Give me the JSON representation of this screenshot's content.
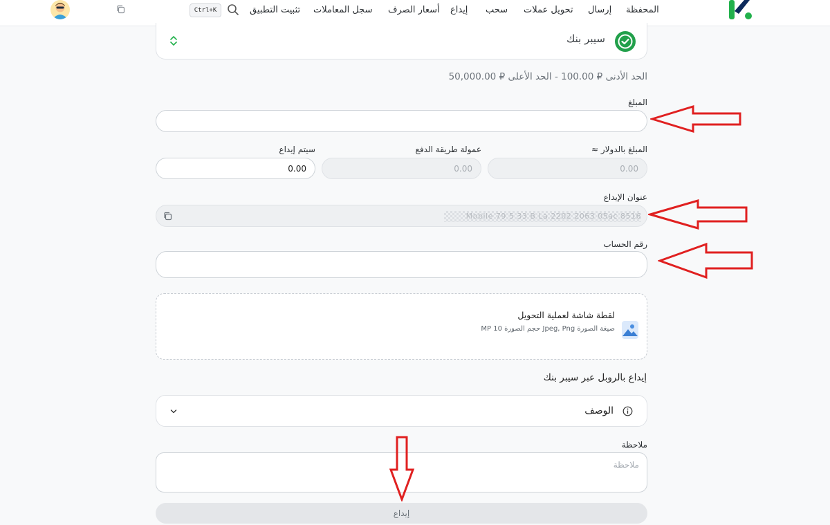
{
  "nav": {
    "items": [
      "المحفظة",
      "إرسال",
      "تحويل عملات",
      "سحب",
      "إيداع",
      "أسعار الصرف",
      "سجل المعاملات",
      "تثبيت التطبيق"
    ],
    "shortcut": "Ctrl+K"
  },
  "bank": {
    "name": "سيبر بنك"
  },
  "limits": {
    "min_label": "الحد الأدنى",
    "min_value": "₽ 100.00",
    "separator": "-",
    "max_label": "الحد الأعلى",
    "max_value": "₽ 50,000.00"
  },
  "form": {
    "amount_label": "المبلغ",
    "amount_value": "",
    "usd_label": "المبلغ بالدولار ≈",
    "usd_value": "0.00",
    "fee_label": "عمولة طريقة الدفع",
    "fee_value": "0.00",
    "deposit_label": "سيتم إيداع",
    "deposit_value": "0.00",
    "address_label": "عنوان الإيداع",
    "address_value": "Mobile 79 5 33 B La 2202 2063 05ac 8516",
    "account_label": "رقم الحساب",
    "account_value": ""
  },
  "upload": {
    "title": "لقطة شاشة لعملية التحويل",
    "hint": "صيغة الصورة Jpeg, Png حجم الصورة 10 MP"
  },
  "section_title": "إيداع بالروبل عبر سيبر بنك",
  "description": {
    "label": "الوصف"
  },
  "note": {
    "label": "ملاحظة",
    "placeholder": "ملاحظة"
  },
  "submit_label": "إيداع",
  "colors": {
    "brand_green": "#22b14c",
    "brand_navy": "#0d2b5c",
    "annotation_red": "#e02020"
  }
}
